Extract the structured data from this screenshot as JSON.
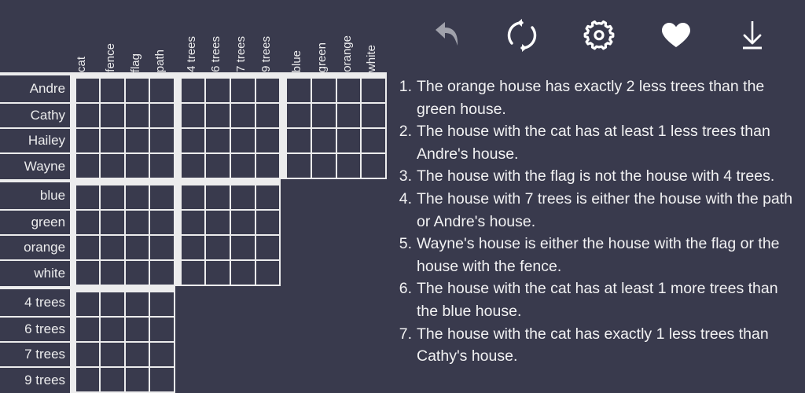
{
  "theme": {
    "background": "#393a4d",
    "grid_line": "#ececed",
    "text": "#f2f2f3",
    "icon_active": "#ffffff",
    "icon_disabled": "#a0a1ab"
  },
  "toolbar": {
    "buttons": [
      {
        "name": "undo-button",
        "icon": "undo-arrow-icon",
        "label": "Undo",
        "state": "disabled"
      },
      {
        "name": "restart-button",
        "icon": "refresh-icon",
        "label": "Restart",
        "state": "enabled"
      },
      {
        "name": "settings-button",
        "icon": "gear-icon",
        "label": "Settings",
        "state": "enabled"
      },
      {
        "name": "favorite-button",
        "icon": "heart-filled-icon",
        "label": "Favorite",
        "state": "enabled"
      },
      {
        "name": "download-button",
        "icon": "download-icon",
        "label": "Download",
        "state": "enabled"
      }
    ]
  },
  "grid": {
    "column_groups": [
      {
        "name": "features",
        "headers": [
          "cat",
          "fence",
          "flag",
          "path"
        ]
      },
      {
        "name": "trees",
        "headers": [
          "4 trees",
          "6 trees",
          "7 trees",
          "9 trees"
        ]
      },
      {
        "name": "colors",
        "headers": [
          "blue",
          "green",
          "orange",
          "white"
        ]
      }
    ],
    "row_groups": [
      {
        "name": "people",
        "labels": [
          "Andre",
          "Cathy",
          "Hailey",
          "Wayne"
        ],
        "blocks": [
          "features",
          "trees",
          "colors"
        ]
      },
      {
        "name": "colors",
        "labels": [
          "blue",
          "green",
          "orange",
          "white"
        ],
        "blocks": [
          "features",
          "trees"
        ]
      },
      {
        "name": "trees",
        "labels": [
          "4 trees",
          "6 trees",
          "7 trees",
          "9 trees"
        ],
        "blocks": [
          "features"
        ]
      }
    ]
  },
  "clues": [
    {
      "number": "1.",
      "text": "The orange house has exactly 2 less trees than the green house."
    },
    {
      "number": "2.",
      "text": "The house with the cat has at least 1 less trees than Andre's house."
    },
    {
      "number": "3.",
      "text": "The house with the flag is not the house with 4 trees."
    },
    {
      "number": "4.",
      "text": "The house with 7 trees is either the house with the path or Andre's house."
    },
    {
      "number": "5.",
      "text": "Wayne's house is either the house with the flag or the house with the fence."
    },
    {
      "number": "6.",
      "text": "The house with the cat has at least 1 more trees than the blue house."
    },
    {
      "number": "7.",
      "text": "The house with the cat has exactly 1 less trees than Cathy's house."
    }
  ]
}
